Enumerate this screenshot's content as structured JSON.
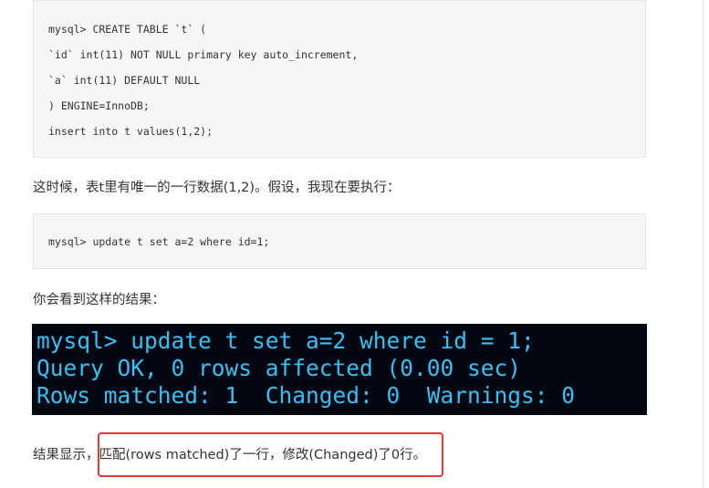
{
  "code_block_1": {
    "lines": [
      "mysql> CREATE TABLE `t` (",
      "`id` int(11) NOT NULL primary key auto_increment,",
      "`a` int(11) DEFAULT NULL",
      ") ENGINE=InnoDB;",
      "insert into t values(1,2);"
    ]
  },
  "paragraph_1": "这时候，表t里有唯一的一行数据(1,2)。假设，我现在要执行：",
  "code_block_2": {
    "line": "mysql> update t set a=2 where id=1;"
  },
  "paragraph_2": "你会看到这样的结果：",
  "terminal": {
    "lines": [
      "mysql> update t set a=2 where id = 1;",
      "Query OK, 0 rows affected (0.00 sec)",
      "Rows matched: 1  Changed: 0  Warnings: 0"
    ],
    "text_color": "#39c0f2",
    "background": "#030712"
  },
  "paragraph_3": {
    "prefix": "结果显示，",
    "highlighted": "匹配(rows matched)了一行，修改(Changed)了0行。"
  },
  "highlight_color": "#e53935"
}
